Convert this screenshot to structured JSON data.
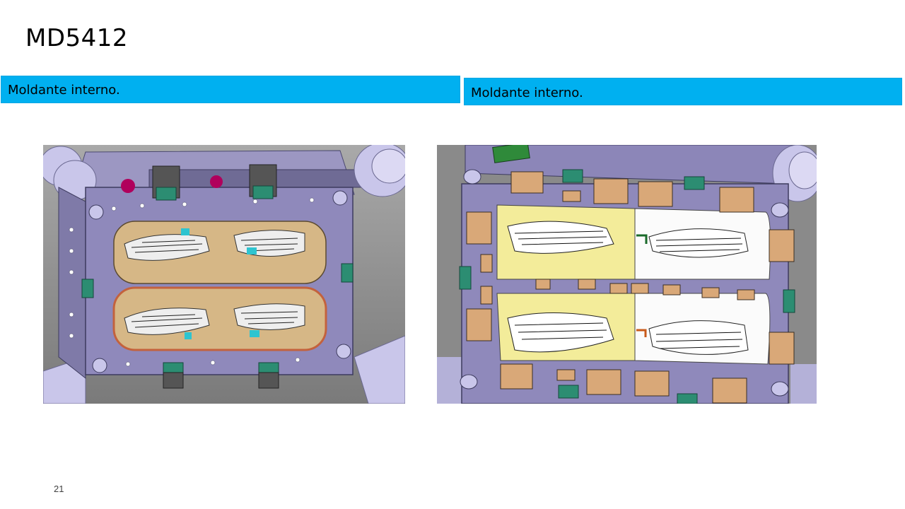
{
  "slide": {
    "title": "MD5412",
    "page_number": "21"
  },
  "panels": [
    {
      "label": "Moldante interno.",
      "image_alt": "CAD view of mold insert, two cavities, isometric"
    },
    {
      "label": "Moldante interno.",
      "image_alt": "CAD view of mold insert, two cavities, front view with highlighted halves"
    }
  ],
  "colors": {
    "banner": "#00b0f0",
    "plate": "#8c86b8",
    "cavity": "#d8bb8c",
    "highlight": "#f5ef9a",
    "background_cad": "#8a8a8a",
    "block": "#d8a978"
  }
}
